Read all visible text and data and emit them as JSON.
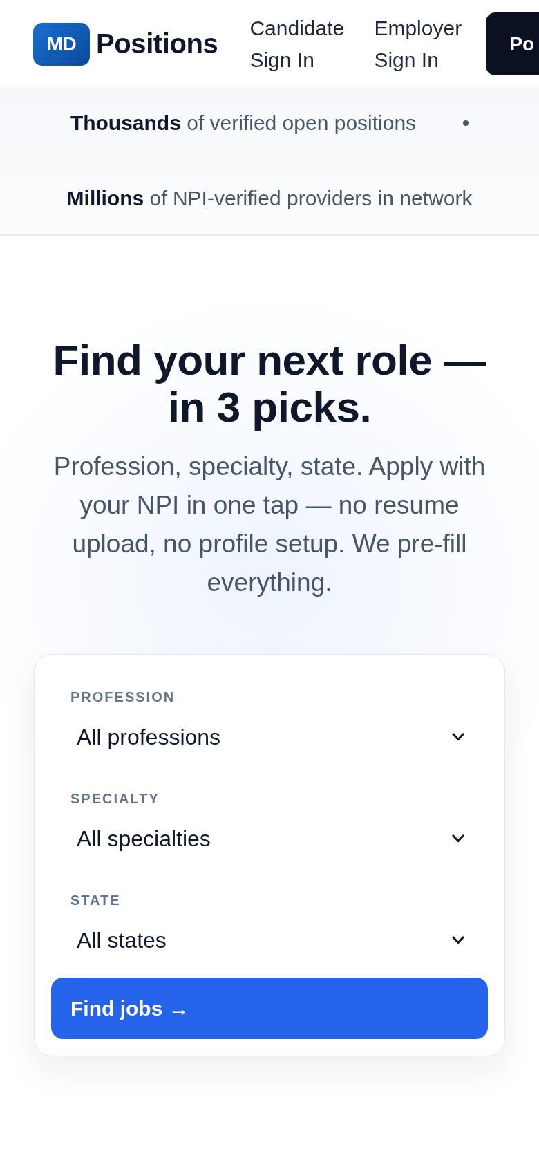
{
  "header": {
    "logo": {
      "badge": "MD",
      "wordmark": "Positions"
    },
    "nav_links": [
      "Candidate Sign In",
      "Employer Sign In"
    ],
    "action_button": "Po"
  },
  "stats": [
    "**Thousands** of verified open positions",
    "**Millions** of NPI-verified providers in network"
  ],
  "hero": {
    "title": "Find your next role — in 3 picks.",
    "subtitle": "Profession, specialty, state. Apply with your NPI in one tap — no resume upload, no profile setup. We pre-fill everything."
  },
  "search_form": {
    "fields": [
      {
        "label": "PROFESSION",
        "value": "All professions"
      },
      {
        "label": "SPECIALTY",
        "value": "All specialties"
      },
      {
        "label": "STATE",
        "value": "All states"
      }
    ],
    "submit_button": "Find jobs →"
  }
}
